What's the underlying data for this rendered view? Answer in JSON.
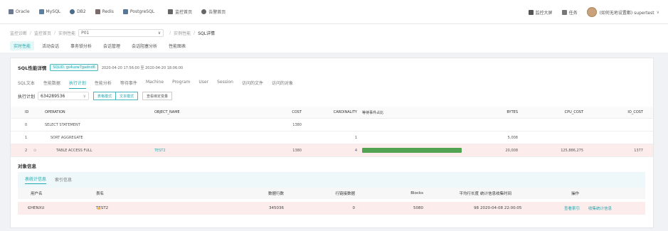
{
  "topnav": {
    "items": [
      {
        "label": "Oracle",
        "icon": "database-icon"
      },
      {
        "label": "MySQL",
        "icon": "mysql-icon"
      },
      {
        "label": "DB2",
        "icon": "db2-icon"
      },
      {
        "label": "Redis",
        "icon": "redis-icon"
      },
      {
        "label": "PostgreSQL",
        "icon": "postgresql-icon"
      },
      {
        "label": "监控首页",
        "icon": "home-icon"
      },
      {
        "label": "告警首页",
        "icon": "alarm-icon"
      }
    ],
    "right": {
      "big_screen": "监控大屏",
      "tasks": "任务",
      "user": "(如何无地设置都) supertest"
    }
  },
  "breadcrumb": {
    "items": [
      "监控诊断",
      "监控首页",
      "实例性能"
    ],
    "instance_select": "P01",
    "tail1": "实例性能",
    "current": "SQL详情"
  },
  "main_tabs": [
    "实时性能",
    "活动会话",
    "事务锁分析",
    "会话管理",
    "会话阻塞分析",
    "性能图表"
  ],
  "sql": {
    "title": "SQL性能详情",
    "sqlid_badge": "SQLID: gs4uzw7gadnd6",
    "time_range": "2020-04-20 17:56:00 至 2020-04-20 18:06:00",
    "tabs": [
      "SQL文本",
      "性能数据",
      "执行计划",
      "性能分析",
      "等待事件",
      "Machine",
      "Program",
      "User",
      "Session",
      "访问的文件",
      "访问的对象"
    ],
    "active_tab": "执行计划"
  },
  "plan": {
    "label": "执行计划",
    "select_value": "634289536",
    "btn_table": "表格模式",
    "btn_text": "文本模式",
    "btn_bind": "查看绑定变量",
    "columns": [
      "ID",
      "OPERATION",
      "OBJECT_NAME",
      "COST",
      "CARDINALITY",
      "等待事件占比",
      "BYTES",
      "CPU_COST",
      "IO_COST"
    ],
    "rows": [
      {
        "id": "0",
        "op": "SELECT STATEMENT",
        "obj": "",
        "cost": "1380",
        "card": "",
        "wait_pct": 0,
        "bytes": "",
        "cpu": "",
        "io": ""
      },
      {
        "id": "1",
        "op": "SORT AGGREGATE",
        "obj": "",
        "cost": "",
        "card": "1",
        "wait_pct": 0,
        "bytes": "5,008",
        "cpu": "",
        "io": ""
      },
      {
        "id": "2",
        "op": "TABLE ACCESS FULL",
        "obj": "TEST2",
        "cost": "1380",
        "card": "4",
        "wait_pct": 100,
        "bytes": "20,008",
        "cpu": "125,886,275",
        "io": "1377"
      }
    ]
  },
  "objects": {
    "title": "对象信息",
    "tabs": [
      "表统计信息",
      "索引信息"
    ],
    "columns": [
      "用户名",
      "表名",
      "数据行数",
      "行链接数据",
      "Blocks",
      "平均行长度",
      "统计信息收集时间",
      "操作"
    ],
    "row": {
      "user": "CHENXU",
      "table": "TEST2",
      "rows": "345036",
      "chained": "0",
      "blocks": "5080",
      "avg_len": "98",
      "collected": "2020-04-08 22:00:05",
      "action1": "查看索引",
      "action2": "收集统计信息"
    }
  },
  "colors": {
    "accent": "#23a8ad",
    "bar": "#52a352",
    "highlight_row": "#fdecec"
  }
}
